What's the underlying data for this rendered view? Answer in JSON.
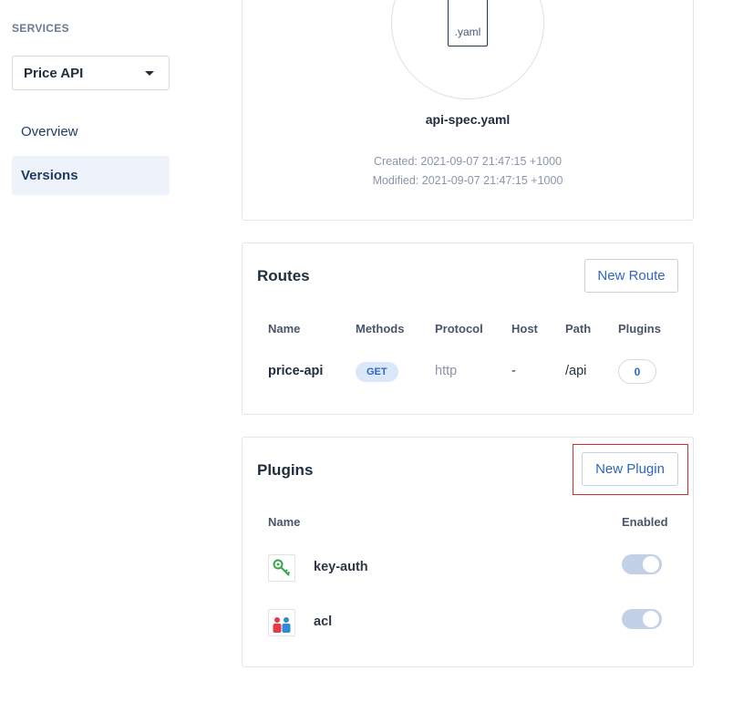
{
  "sidebar": {
    "section_label": "SERVICES",
    "service_select": {
      "value": "Price API"
    },
    "nav": [
      {
        "label": "Overview",
        "active": false
      },
      {
        "label": "Versions",
        "active": true
      }
    ]
  },
  "spec": {
    "file_ext": ".yaml",
    "file_name": "api-spec.yaml",
    "created": "Created: 2021-09-07 21:47:15 +1000",
    "modified": "Modified: 2021-09-07 21:47:15 +1000"
  },
  "routes": {
    "title": "Routes",
    "new_button": "New Route",
    "columns": [
      "Name",
      "Methods",
      "Protocol",
      "Host",
      "Path",
      "Plugins"
    ],
    "rows": [
      {
        "name": "price-api",
        "method": "GET",
        "protocol": "http",
        "host": "-",
        "path": "/api",
        "plugins": "0"
      }
    ]
  },
  "plugins": {
    "title": "Plugins",
    "new_button": "New Plugin",
    "columns": [
      "Name",
      "Enabled"
    ],
    "rows": [
      {
        "name": "key-auth",
        "icon": "key-icon",
        "enabled": true
      },
      {
        "name": "acl",
        "icon": "users-icon",
        "enabled": true
      }
    ]
  },
  "colors": {
    "accent": "#2f66c2",
    "highlight": "#d42b2b",
    "active_nav_bg": "#eef3fb"
  }
}
